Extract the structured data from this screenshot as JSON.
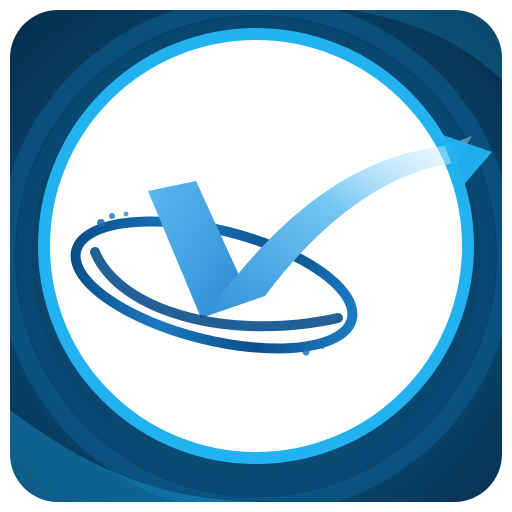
{
  "app_icon": {
    "icon_name": "checkmark-v-logo-icon",
    "colors": {
      "tile_dark": "#0a3f62",
      "tile_mid": "#0f5a86",
      "tile_ring": "#1aa7e8",
      "ring_border": "#22b2f0",
      "circle_fill": "#ffffff",
      "check_light": "#4aa9e6",
      "check_dark": "#1d6fb8",
      "orbit_dark": "#0b4f8a",
      "orbit_light": "#1b7ac2"
    }
  }
}
